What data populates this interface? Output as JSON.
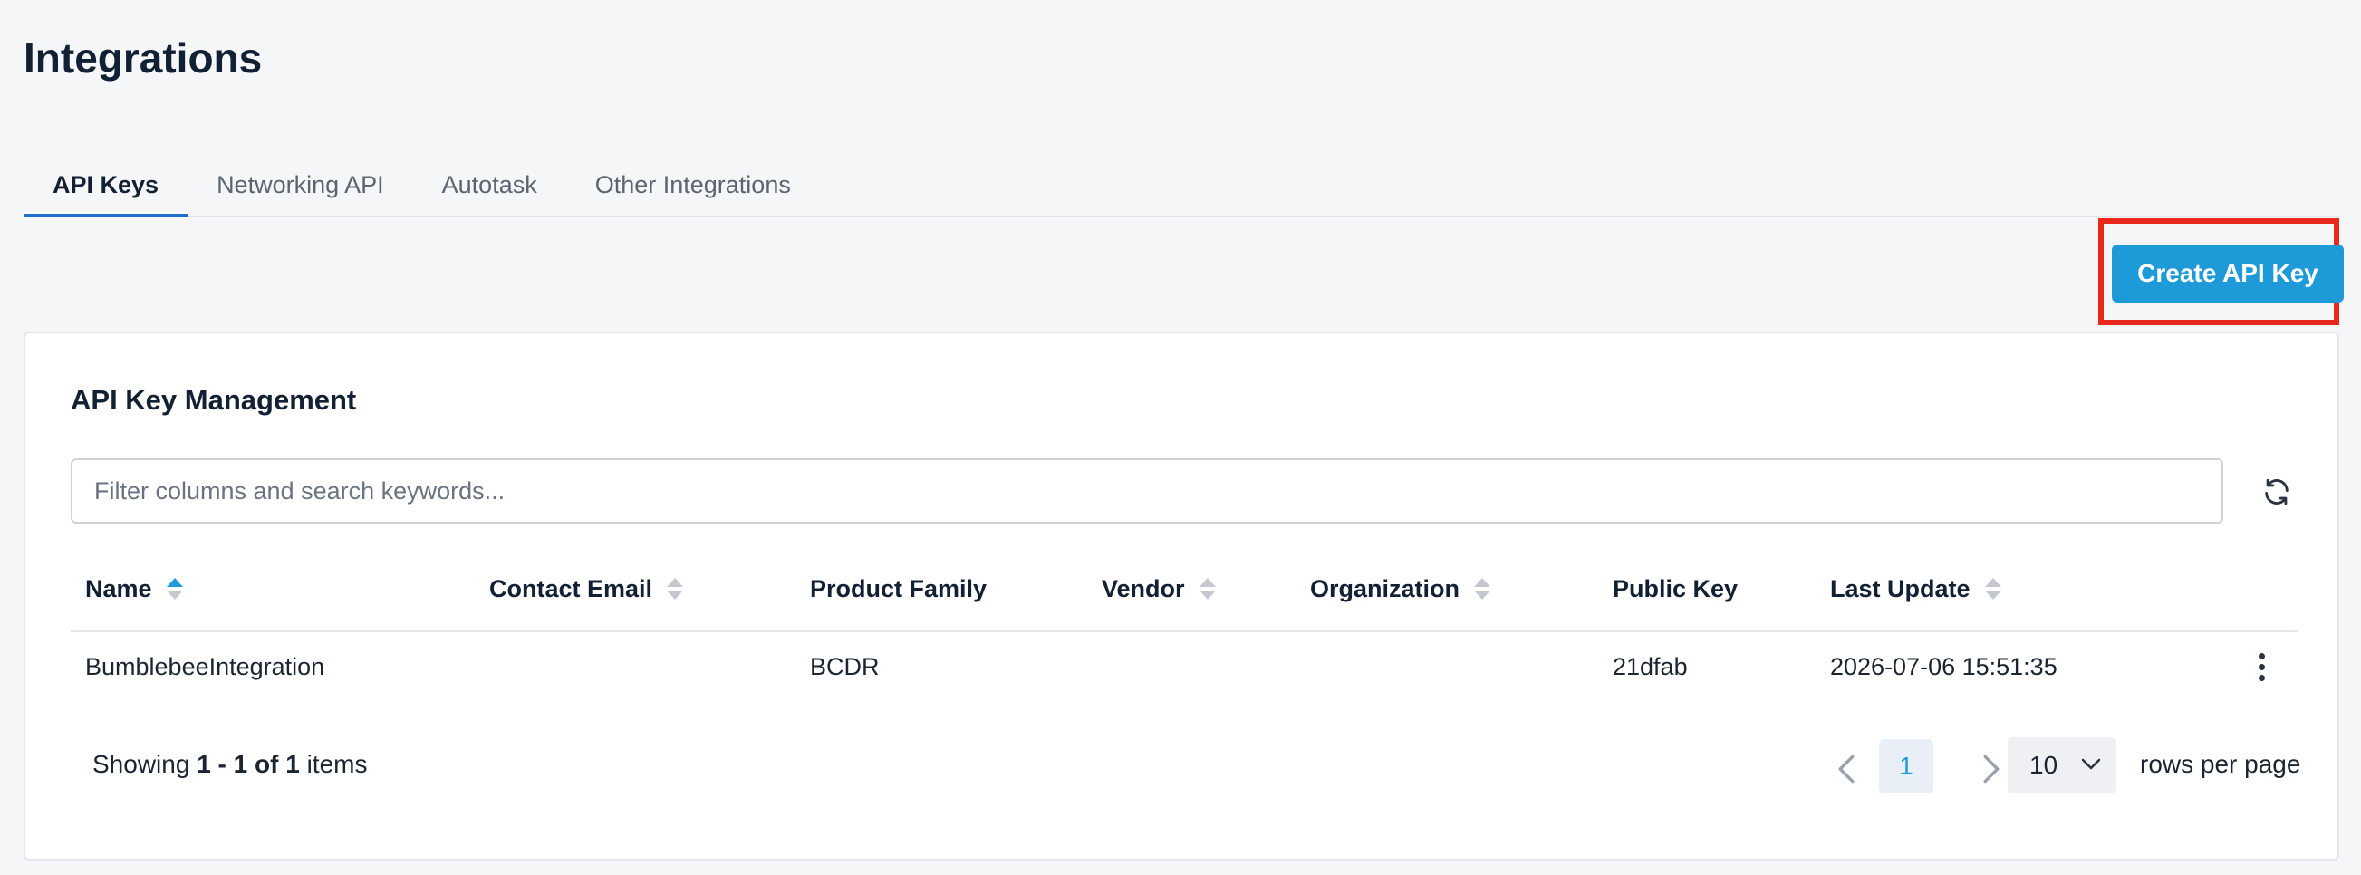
{
  "page": {
    "title": "Integrations"
  },
  "tabs": [
    {
      "label": "API Keys",
      "active": true
    },
    {
      "label": "Networking API",
      "active": false
    },
    {
      "label": "Autotask",
      "active": false
    },
    {
      "label": "Other Integrations",
      "active": false
    }
  ],
  "toolbar": {
    "create_label": "Create API Key"
  },
  "card": {
    "title": "API Key Management",
    "search_placeholder": "Filter columns and search keywords..."
  },
  "table": {
    "columns": [
      "Name",
      "Contact Email",
      "Product Family",
      "Vendor",
      "Organization",
      "Public Key",
      "Last Update"
    ],
    "sort": {
      "column": "Name",
      "direction": "asc"
    },
    "rows": [
      {
        "name": "BumblebeeIntegration",
        "contact_email": "",
        "product_family": "BCDR",
        "vendor": "",
        "organization": "",
        "public_key": "21dfab",
        "last_update": "2026-07-06 15:51:35"
      }
    ]
  },
  "pagination": {
    "showing_prefix": "Showing",
    "range": "1 - 1 of 1",
    "items_suffix": "items",
    "current_page": "1",
    "rows_per_page": "10",
    "rows_per_page_label": "rows per page"
  },
  "colors": {
    "accent": "#1e9ad9",
    "tab_indicator": "#1f6fd1",
    "highlight": "#e8281a"
  }
}
